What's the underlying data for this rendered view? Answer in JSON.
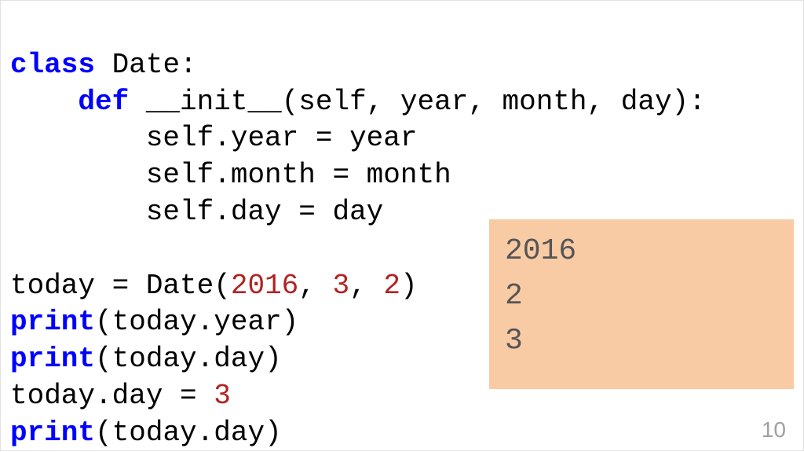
{
  "code": {
    "line1_kw": "class",
    "line1_rest": " Date:",
    "line2_indent": "    ",
    "line2_kw": "def",
    "line2_rest": " __init__(self, year, month, day):",
    "line3": "        self.year = year",
    "line4": "        self.month = month",
    "line5": "        self.day = day",
    "line6": "",
    "line7_a": "today = Date(",
    "line7_n1": "2016",
    "line7_b": ", ",
    "line7_n2": "3",
    "line7_c": ", ",
    "line7_n3": "2",
    "line7_d": ")",
    "line8_kw": "print",
    "line8_rest": "(today.year)",
    "line9_kw": "print",
    "line9_rest": "(today.day)",
    "line10_a": "today.day = ",
    "line10_n": "3",
    "line11_kw": "print",
    "line11_rest": "(today.day)"
  },
  "output": {
    "line1": "2016",
    "line2": "2",
    "line3": "3"
  },
  "page_number": "10"
}
